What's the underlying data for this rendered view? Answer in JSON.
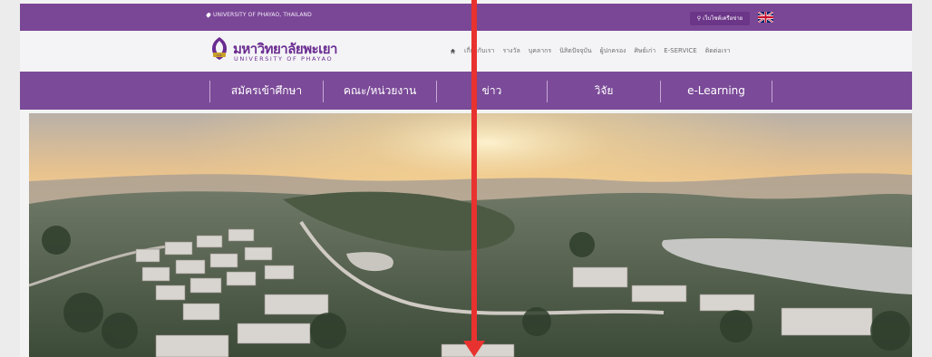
{
  "topbar": {
    "location": "UNIVERSITY OF PHAYAO, THAILAND",
    "search_label": "เว็บไซต์เครือข่าย",
    "flag_icon": "uk-flag-icon"
  },
  "logo": {
    "thai_name": "มหาวิทยาลัยพะเยา",
    "english_name": "UNIVERSITY OF PHAYAO",
    "brand_color": "#6a2c91"
  },
  "top_nav": {
    "home_icon": "home-icon",
    "items": [
      "เกี่ยวกับเรา",
      "รางวัล",
      "บุคลากร",
      "นิสิตปัจจุบัน",
      "ผู้ปกครอง",
      "ศิษย์เก่า",
      "E-SERVICE",
      "ติดต่อเรา"
    ]
  },
  "main_nav": {
    "items": [
      "สมัครเข้าศึกษา",
      "คณะ/หน่วยงาน",
      "ข่าว",
      "วิจัย",
      "e-Learning"
    ],
    "color": "#7b4a98"
  },
  "hero": {
    "description_icon": "campus-aerial-photo"
  },
  "overlay": {
    "arrow_color": "#e8322f"
  }
}
